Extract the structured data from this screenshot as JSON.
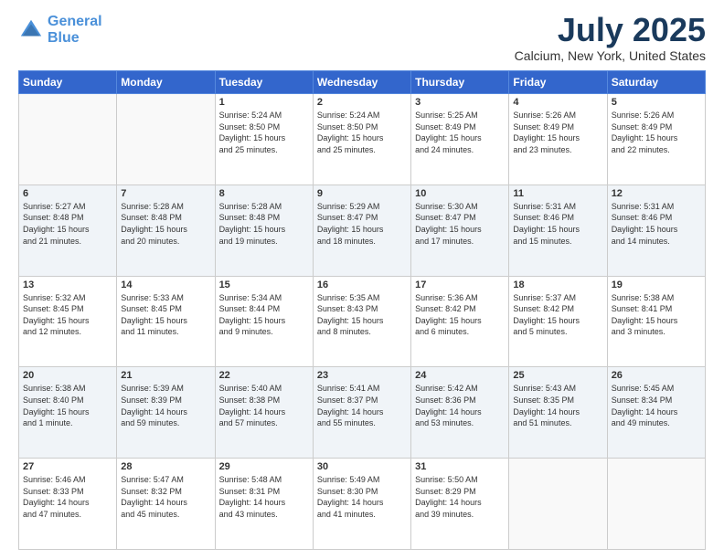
{
  "logo": {
    "line1": "General",
    "line2": "Blue"
  },
  "header": {
    "month": "July 2025",
    "location": "Calcium, New York, United States"
  },
  "weekdays": [
    "Sunday",
    "Monday",
    "Tuesday",
    "Wednesday",
    "Thursday",
    "Friday",
    "Saturday"
  ],
  "weeks": [
    [
      {
        "day": "",
        "info": ""
      },
      {
        "day": "",
        "info": ""
      },
      {
        "day": "1",
        "info": "Sunrise: 5:24 AM\nSunset: 8:50 PM\nDaylight: 15 hours\nand 25 minutes."
      },
      {
        "day": "2",
        "info": "Sunrise: 5:24 AM\nSunset: 8:50 PM\nDaylight: 15 hours\nand 25 minutes."
      },
      {
        "day": "3",
        "info": "Sunrise: 5:25 AM\nSunset: 8:49 PM\nDaylight: 15 hours\nand 24 minutes."
      },
      {
        "day": "4",
        "info": "Sunrise: 5:26 AM\nSunset: 8:49 PM\nDaylight: 15 hours\nand 23 minutes."
      },
      {
        "day": "5",
        "info": "Sunrise: 5:26 AM\nSunset: 8:49 PM\nDaylight: 15 hours\nand 22 minutes."
      }
    ],
    [
      {
        "day": "6",
        "info": "Sunrise: 5:27 AM\nSunset: 8:48 PM\nDaylight: 15 hours\nand 21 minutes."
      },
      {
        "day": "7",
        "info": "Sunrise: 5:28 AM\nSunset: 8:48 PM\nDaylight: 15 hours\nand 20 minutes."
      },
      {
        "day": "8",
        "info": "Sunrise: 5:28 AM\nSunset: 8:48 PM\nDaylight: 15 hours\nand 19 minutes."
      },
      {
        "day": "9",
        "info": "Sunrise: 5:29 AM\nSunset: 8:47 PM\nDaylight: 15 hours\nand 18 minutes."
      },
      {
        "day": "10",
        "info": "Sunrise: 5:30 AM\nSunset: 8:47 PM\nDaylight: 15 hours\nand 17 minutes."
      },
      {
        "day": "11",
        "info": "Sunrise: 5:31 AM\nSunset: 8:46 PM\nDaylight: 15 hours\nand 15 minutes."
      },
      {
        "day": "12",
        "info": "Sunrise: 5:31 AM\nSunset: 8:46 PM\nDaylight: 15 hours\nand 14 minutes."
      }
    ],
    [
      {
        "day": "13",
        "info": "Sunrise: 5:32 AM\nSunset: 8:45 PM\nDaylight: 15 hours\nand 12 minutes."
      },
      {
        "day": "14",
        "info": "Sunrise: 5:33 AM\nSunset: 8:45 PM\nDaylight: 15 hours\nand 11 minutes."
      },
      {
        "day": "15",
        "info": "Sunrise: 5:34 AM\nSunset: 8:44 PM\nDaylight: 15 hours\nand 9 minutes."
      },
      {
        "day": "16",
        "info": "Sunrise: 5:35 AM\nSunset: 8:43 PM\nDaylight: 15 hours\nand 8 minutes."
      },
      {
        "day": "17",
        "info": "Sunrise: 5:36 AM\nSunset: 8:42 PM\nDaylight: 15 hours\nand 6 minutes."
      },
      {
        "day": "18",
        "info": "Sunrise: 5:37 AM\nSunset: 8:42 PM\nDaylight: 15 hours\nand 5 minutes."
      },
      {
        "day": "19",
        "info": "Sunrise: 5:38 AM\nSunset: 8:41 PM\nDaylight: 15 hours\nand 3 minutes."
      }
    ],
    [
      {
        "day": "20",
        "info": "Sunrise: 5:38 AM\nSunset: 8:40 PM\nDaylight: 15 hours\nand 1 minute."
      },
      {
        "day": "21",
        "info": "Sunrise: 5:39 AM\nSunset: 8:39 PM\nDaylight: 14 hours\nand 59 minutes."
      },
      {
        "day": "22",
        "info": "Sunrise: 5:40 AM\nSunset: 8:38 PM\nDaylight: 14 hours\nand 57 minutes."
      },
      {
        "day": "23",
        "info": "Sunrise: 5:41 AM\nSunset: 8:37 PM\nDaylight: 14 hours\nand 55 minutes."
      },
      {
        "day": "24",
        "info": "Sunrise: 5:42 AM\nSunset: 8:36 PM\nDaylight: 14 hours\nand 53 minutes."
      },
      {
        "day": "25",
        "info": "Sunrise: 5:43 AM\nSunset: 8:35 PM\nDaylight: 14 hours\nand 51 minutes."
      },
      {
        "day": "26",
        "info": "Sunrise: 5:45 AM\nSunset: 8:34 PM\nDaylight: 14 hours\nand 49 minutes."
      }
    ],
    [
      {
        "day": "27",
        "info": "Sunrise: 5:46 AM\nSunset: 8:33 PM\nDaylight: 14 hours\nand 47 minutes."
      },
      {
        "day": "28",
        "info": "Sunrise: 5:47 AM\nSunset: 8:32 PM\nDaylight: 14 hours\nand 45 minutes."
      },
      {
        "day": "29",
        "info": "Sunrise: 5:48 AM\nSunset: 8:31 PM\nDaylight: 14 hours\nand 43 minutes."
      },
      {
        "day": "30",
        "info": "Sunrise: 5:49 AM\nSunset: 8:30 PM\nDaylight: 14 hours\nand 41 minutes."
      },
      {
        "day": "31",
        "info": "Sunrise: 5:50 AM\nSunset: 8:29 PM\nDaylight: 14 hours\nand 39 minutes."
      },
      {
        "day": "",
        "info": ""
      },
      {
        "day": "",
        "info": ""
      }
    ]
  ]
}
